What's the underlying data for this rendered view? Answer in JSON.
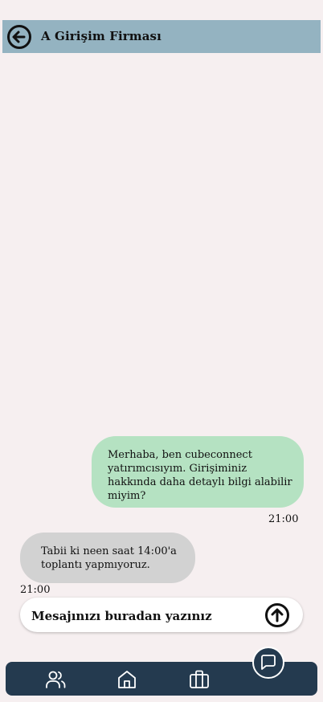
{
  "header": {
    "title": "A Girişim Firması",
    "back_icon": "arrow-left-circle-icon"
  },
  "messages": [
    {
      "direction": "outgoing",
      "text": "Merhaba, ben cubeconnect yatırımcısıyım. Girişiminiz hakkında daha detaylı bilgi alabilir miyim?",
      "time": "21:00"
    },
    {
      "direction": "incoming",
      "text": "Tabii ki neen saat 14:00'a toplantı yapmıyoruz.",
      "time": "21:00"
    }
  ],
  "composer": {
    "placeholder": "Mesajınızı buradan yazınız",
    "send_icon": "arrow-up-circle-icon"
  },
  "nav": {
    "items": [
      {
        "icon": "users-icon"
      },
      {
        "icon": "home-icon"
      },
      {
        "icon": "briefcase-icon"
      }
    ],
    "fab_icon": "chat-bubble-icon"
  },
  "colors": {
    "background": "#f6eff0",
    "header": "#94b3c1",
    "outgoing_bubble": "#b5e2c2",
    "incoming_bubble": "#d2d2d2",
    "nav": "#243a4f"
  }
}
